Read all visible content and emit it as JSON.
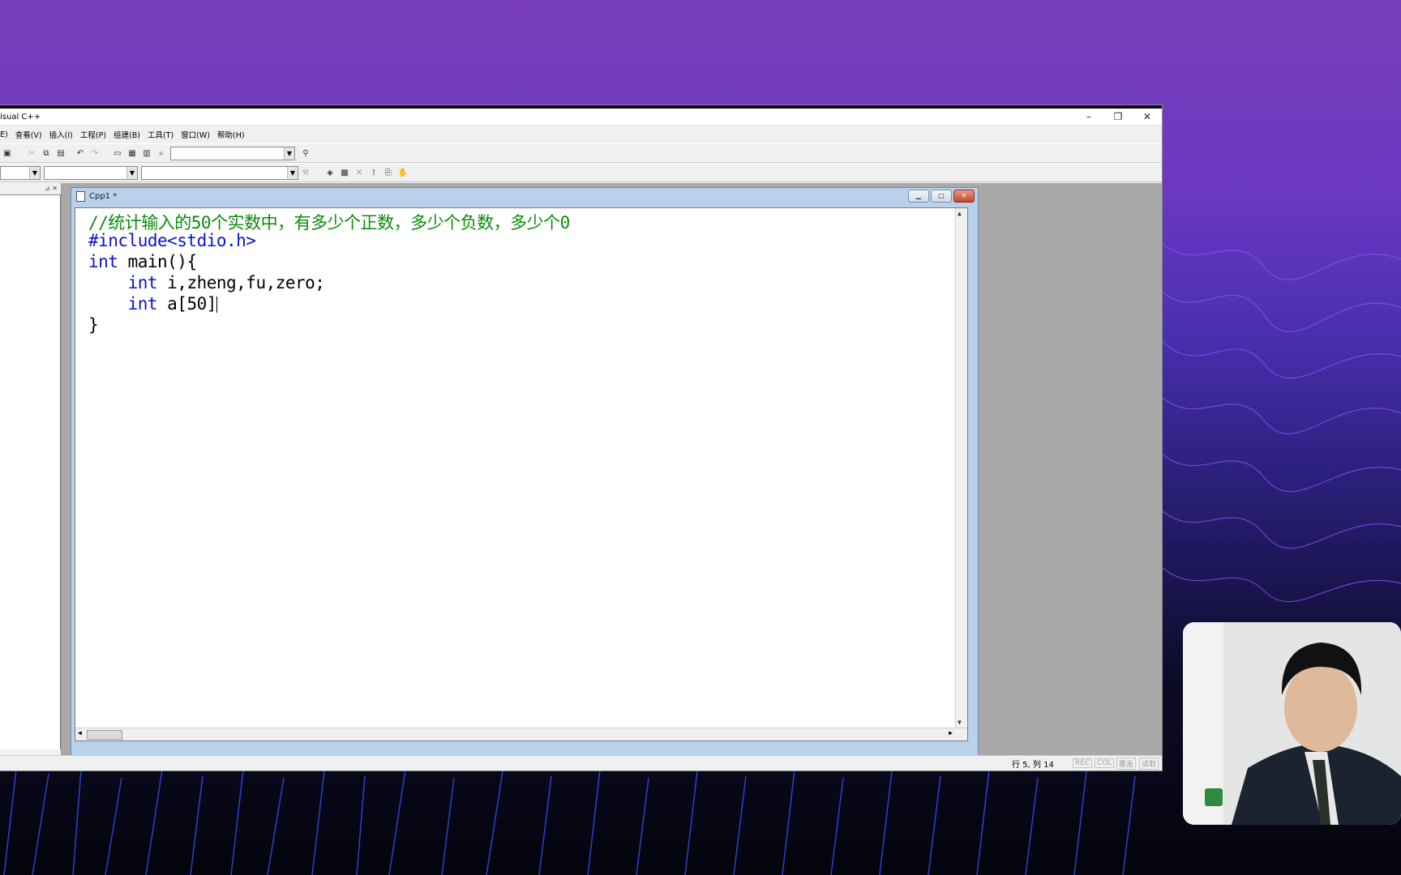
{
  "window": {
    "title": "isual C++",
    "controls": [
      "–",
      "❐",
      "✕"
    ]
  },
  "menu": [
    "E)",
    "查看(V)",
    "插入(I)",
    "工程(P)",
    "组建(B)",
    "工具(T)",
    "窗口(W)",
    "帮助(H)"
  ],
  "document": {
    "title": "Cpp1 *",
    "code": [
      {
        "text": "//统计输入的50个实数中，有多少个正数，多少个负数，多少个0",
        "kind": "comment"
      },
      {
        "text": "#include<stdio.h>",
        "kind": "preproc"
      },
      {
        "kw": "int",
        "rest": " main(){"
      },
      {
        "indent": "    ",
        "kw": "int",
        "rest": " i,zheng,fu,zero;"
      },
      {
        "indent": "    ",
        "kw": "int",
        "rest": " a[50]"
      },
      {
        "text": "}",
        "kind": "plain"
      }
    ]
  },
  "status": {
    "position": "行 5, 列 14",
    "indicators": [
      "REC",
      "COL",
      "覆盖",
      "读取"
    ]
  },
  "colors": {
    "comment": "#0c8a0c",
    "keyword": "#1010d0",
    "child_frame": "#b9d1ea"
  }
}
